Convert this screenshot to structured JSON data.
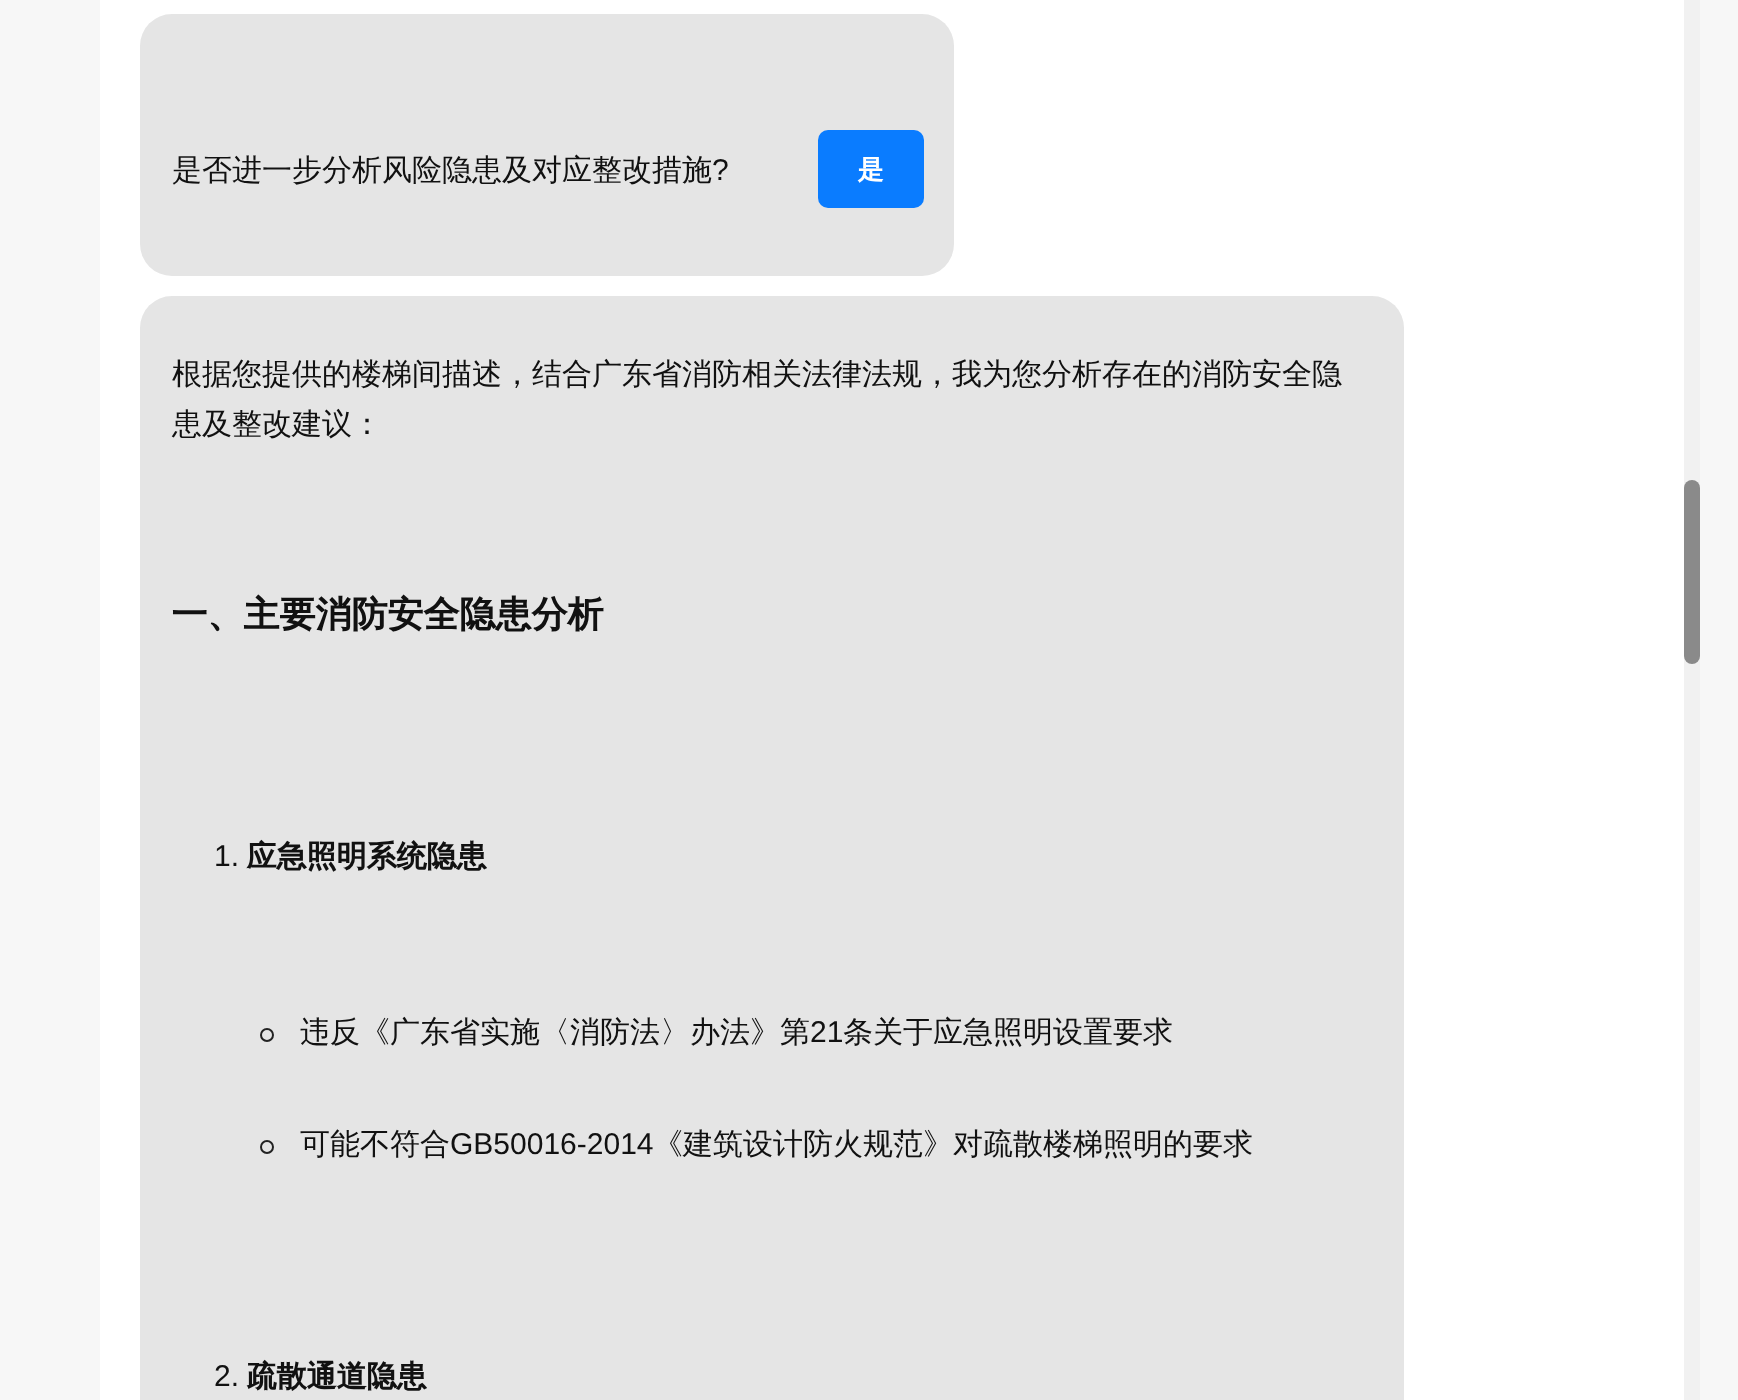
{
  "messages": [
    {
      "kind": "question",
      "text": "是否进一步分析风险隐患及对应整改措施?",
      "buttons": [
        {
          "label": "是"
        }
      ]
    },
    {
      "kind": "answer",
      "intro": "根据您提供的楼梯间描述，结合广东省消防相关法律法规，我为您分析存在的消防安全隐患及整改建议：",
      "heading": "一、主要消防安全隐患分析",
      "sections": [
        {
          "number": "1.",
          "title": "应急照明系统隐患",
          "points": [
            "违反《广东省实施〈消防法〉办法》第21条关于应急照明设置要求",
            "可能不符合GB50016-2014《建筑设计防火规范》对疏散楼梯照明的要求"
          ]
        },
        {
          "number": "2.",
          "title": "疏散通道隐患"
        }
      ]
    }
  ]
}
